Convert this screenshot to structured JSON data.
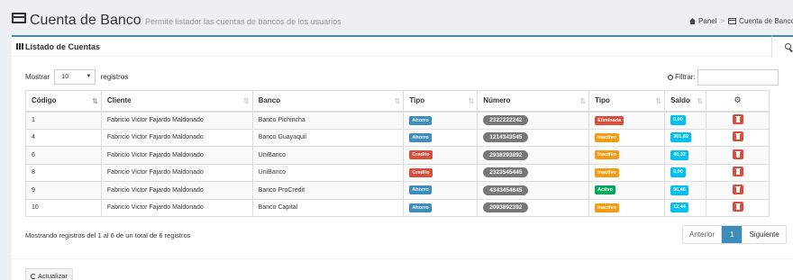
{
  "header": {
    "title": "Cuenta de Banco",
    "subtitle": "Permite listador las cuentas de bancos de los usuarios",
    "breadcrumb": {
      "home": "Panel",
      "current": "Cuenta de Banco"
    }
  },
  "box": {
    "title": "Listado de Cuentas",
    "length": {
      "prefix": "Mostrar",
      "value": "10",
      "suffix": "registros"
    },
    "filter": {
      "label": "Filtrar:",
      "value": ""
    }
  },
  "table": {
    "columns": [
      "Código",
      "Cliente",
      "Banco",
      "Tipo",
      "Número",
      "Tipo",
      "Saldo"
    ],
    "rows": [
      {
        "codigo": "1",
        "cliente": "Fabricio Victor Fajardo Maldonado",
        "banco": "Banco Pichincha",
        "tipo": "Ahorro",
        "numero": "2322222242",
        "estado": "Eliminada",
        "saldo": "0,00"
      },
      {
        "codigo": "4",
        "cliente": "Fabricio Victor Fajardo Maldonado",
        "banco": "Banco Guayaquil",
        "tipo": "Ahorro",
        "numero": "1214343545",
        "estado": "Inactivo",
        "saldo": "301,89"
      },
      {
        "codigo": "6",
        "cliente": "Fabricio Victor Fajardo Maldonado",
        "banco": "UniBanco",
        "tipo": "Credito",
        "numero": "2938293892",
        "estado": "Inactivo",
        "saldo": "40,32"
      },
      {
        "codigo": "8",
        "cliente": "Fabricio Victor Fajardo Maldonado",
        "banco": "UniBanco",
        "tipo": "Credito",
        "numero": "2323545445",
        "estado": "Inactivo",
        "saldo": "0,00"
      },
      {
        "codigo": "9",
        "cliente": "Fabricio Victor Fajardo Maldonado",
        "banco": "Banco ProCredit",
        "tipo": "Ahorro",
        "numero": "4343454645",
        "estado": "Activo",
        "saldo": "50,46"
      },
      {
        "codigo": "10",
        "cliente": "Fabricio Victor Fajardo Maldonado",
        "banco": "Banco Capital",
        "tipo": "Ahorro",
        "numero": "2093892392",
        "estado": "Inactivo",
        "saldo": "12,44"
      }
    ]
  },
  "footer": {
    "info": "Mostrando registros del 1 al 6 de un total de 6 registros",
    "pager": {
      "prev": "Anterior",
      "page": "1",
      "next": "Siguiente"
    },
    "refresh": "Actualizar"
  },
  "icons": {
    "header": "credit-card-icon",
    "list": "list-icon",
    "search": "search-icon",
    "filter": "search-icon",
    "settings": "gear-icon",
    "delete": "trash-icon",
    "refresh": "refresh-icon"
  },
  "colors": {
    "primary": "#3c8dbc",
    "ahorro": "#3c8dbc",
    "credito": "#dd4b39",
    "eliminada": "#dd4b39",
    "inactivo": "#f39c12",
    "activo": "#00a65a",
    "saldo": "#00c0ef",
    "numero": "#777777",
    "delete": "#dd4b39"
  }
}
